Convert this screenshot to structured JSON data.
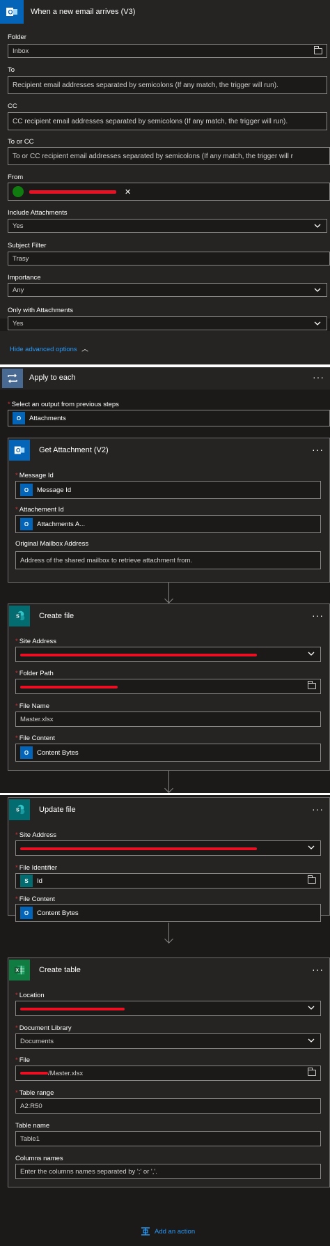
{
  "trigger": {
    "title": "When a new email arrives (V3)",
    "fields": {
      "folder": {
        "label": "Folder",
        "value": "Inbox"
      },
      "to": {
        "label": "To",
        "placeholder": "Recipient email addresses separated by semicolons (If any match, the trigger will run)."
      },
      "cc": {
        "label": "CC",
        "placeholder": "CC recipient email addresses separated by semicolons (If any match, the trigger will run)."
      },
      "to_or_cc": {
        "label": "To or CC",
        "placeholder": "To or CC recipient email addresses separated by semicolons (If any match, the trigger will r"
      },
      "from": {
        "label": "From",
        "remove": "✕"
      },
      "include_attachments": {
        "label": "Include Attachments",
        "value": "Yes"
      },
      "subject_filter": {
        "label": "Subject Filter",
        "value": "Trasy"
      },
      "importance": {
        "label": "Importance",
        "value": "Any"
      },
      "only_with_attachments": {
        "label": "Only with Attachments",
        "value": "Yes"
      }
    },
    "advanced_link": "Hide advanced options"
  },
  "apply_to_each": {
    "title": "Apply to each",
    "select_label": "Select an output from previous steps",
    "token": "Attachments",
    "more": "···"
  },
  "get_attachment": {
    "title": "Get Attachment (V2)",
    "more": "···",
    "message_id": {
      "label": "Message Id",
      "token": "Message Id"
    },
    "attachment_id": {
      "label": "Attachement Id",
      "token": "Attachments A..."
    },
    "mailbox": {
      "label": "Original Mailbox Address",
      "placeholder": "Address of the shared mailbox to retrieve attachment from."
    }
  },
  "create_file": {
    "title": "Create file",
    "more": "···",
    "site_address": {
      "label": "Site Address"
    },
    "folder_path": {
      "label": "Folder Path"
    },
    "file_name": {
      "label": "File Name",
      "value": "Master.xlsx"
    },
    "file_content": {
      "label": "File Content",
      "token": "Content Bytes"
    }
  },
  "update_file": {
    "title": "Update file",
    "more": "···",
    "site_address": {
      "label": "Site Address"
    },
    "file_identifier": {
      "label": "File Identifier",
      "token": "Id"
    },
    "file_content": {
      "label": "File Content",
      "token": "Content Bytes"
    }
  },
  "create_table": {
    "title": "Create table",
    "more": "···",
    "location": {
      "label": "Location"
    },
    "document_library": {
      "label": "Document Library",
      "value": "Documents"
    },
    "file": {
      "label": "File",
      "value": "/Master.xlsx"
    },
    "table_range": {
      "label": "Table range",
      "value": "A2:R50"
    },
    "table_name": {
      "label": "Table name",
      "value": "Table1"
    },
    "columns_names": {
      "label": "Columns names",
      "placeholder": "Enter the columns names separated by ';' or ','."
    }
  },
  "add_action": "Add an action",
  "colors": {
    "outlook": "#0364b8",
    "sharepoint": "#036c70",
    "excel": "#107c41",
    "loop": "#486991",
    "link": "#2899f5",
    "redaction": "#e81123"
  }
}
